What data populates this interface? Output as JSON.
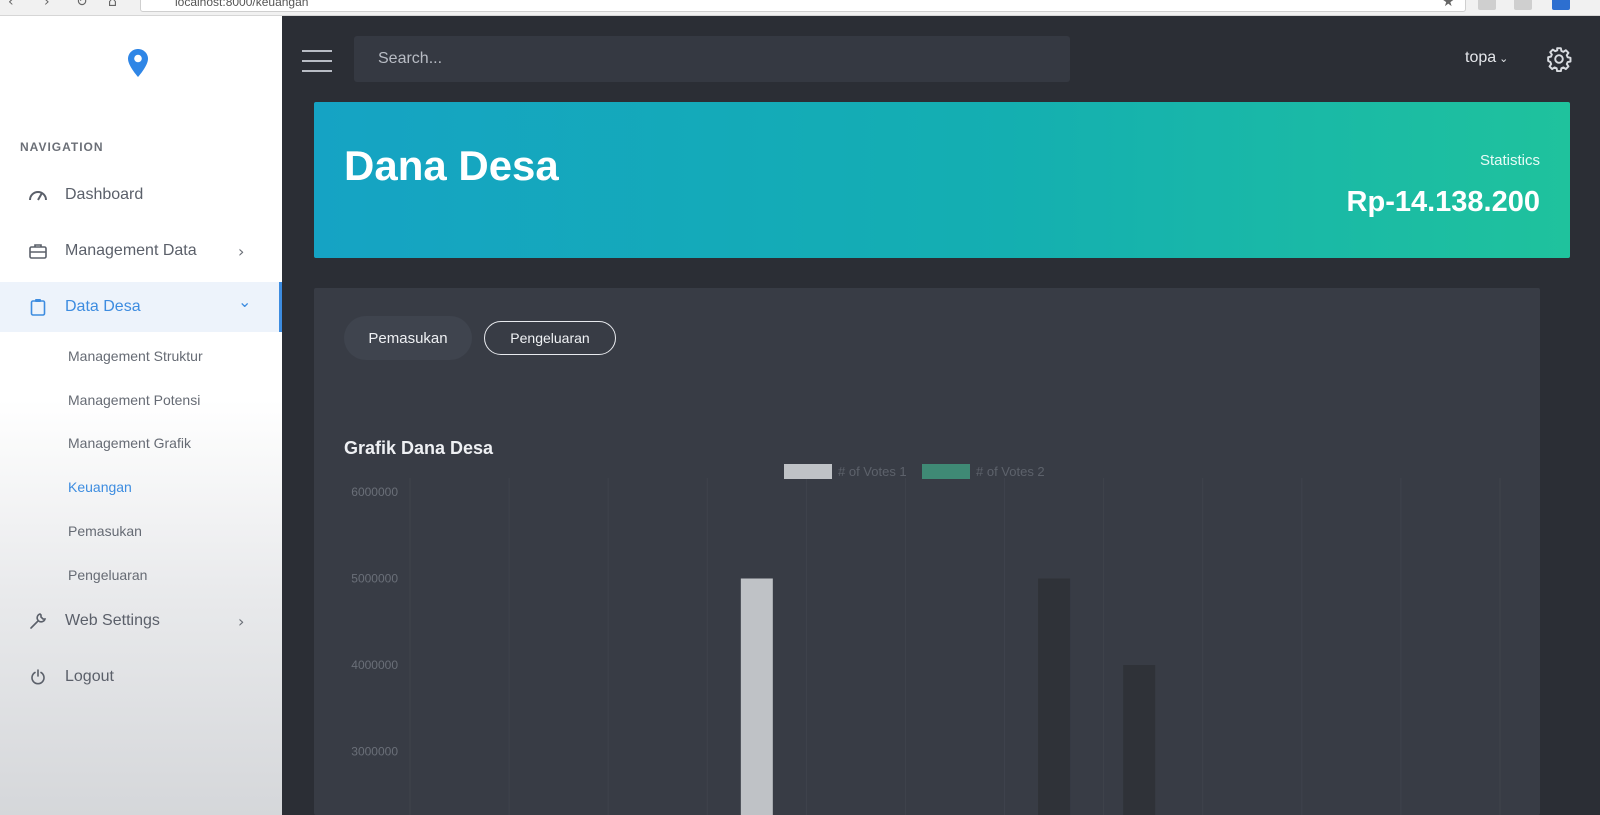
{
  "browser": {
    "url": "localhost:8000/keuangan"
  },
  "sidebar": {
    "heading": "NAVIGATION",
    "items": [
      {
        "label": "Dashboard",
        "icon": "dashboard-gauge-icon"
      },
      {
        "label": "Management Data",
        "icon": "briefcase-icon",
        "chevron": "›"
      },
      {
        "label": "Data Desa",
        "icon": "clipboard-icon",
        "chevron": "⌄"
      },
      {
        "label": "Web Settings",
        "icon": "wrench-icon",
        "chevron": "›"
      },
      {
        "label": "Logout",
        "icon": "power-icon"
      }
    ],
    "sub_items": [
      {
        "label": "Management Struktur"
      },
      {
        "label": "Management Potensi"
      },
      {
        "label": "Management Grafik"
      },
      {
        "label": "Keuangan"
      },
      {
        "label": "Pemasukan"
      },
      {
        "label": "Pengeluaran"
      }
    ],
    "active_item": "Data Desa",
    "active_sub_item": "Keuangan"
  },
  "topbar": {
    "search_placeholder": "Search...",
    "user": "topa"
  },
  "banner": {
    "title": "Dana Desa",
    "stat_label": "Statistics",
    "stat_value": "Rp-14.138.200"
  },
  "tabs": [
    {
      "label": "Pemasukan"
    },
    {
      "label": "Pengeluaran"
    }
  ],
  "chart_data": {
    "type": "bar",
    "title": "Grafik Dana Desa",
    "series": [
      {
        "name": "# of Votes 1",
        "color": "#bfc2c6",
        "values": [
          0,
          0,
          0,
          5000000,
          0,
          0,
          0,
          0,
          0,
          0,
          0
        ]
      },
      {
        "name": "# of Votes 2",
        "color": "#2f3238",
        "values": [
          0,
          0,
          0,
          0,
          0,
          0,
          5000000,
          4000000,
          0,
          0,
          0
        ]
      }
    ],
    "ytick_labels": [
      "6000000",
      "5000000",
      "4000000",
      "3000000"
    ],
    "ylim": [
      3000000,
      6000000
    ],
    "legend_placement": "top-center",
    "grid": true
  },
  "colors": {
    "accent": "#3d8ce0",
    "banner_start": "#15a3c4",
    "banner_end": "#1fc29d",
    "card": "#383c45",
    "background": "#2b2e35"
  }
}
